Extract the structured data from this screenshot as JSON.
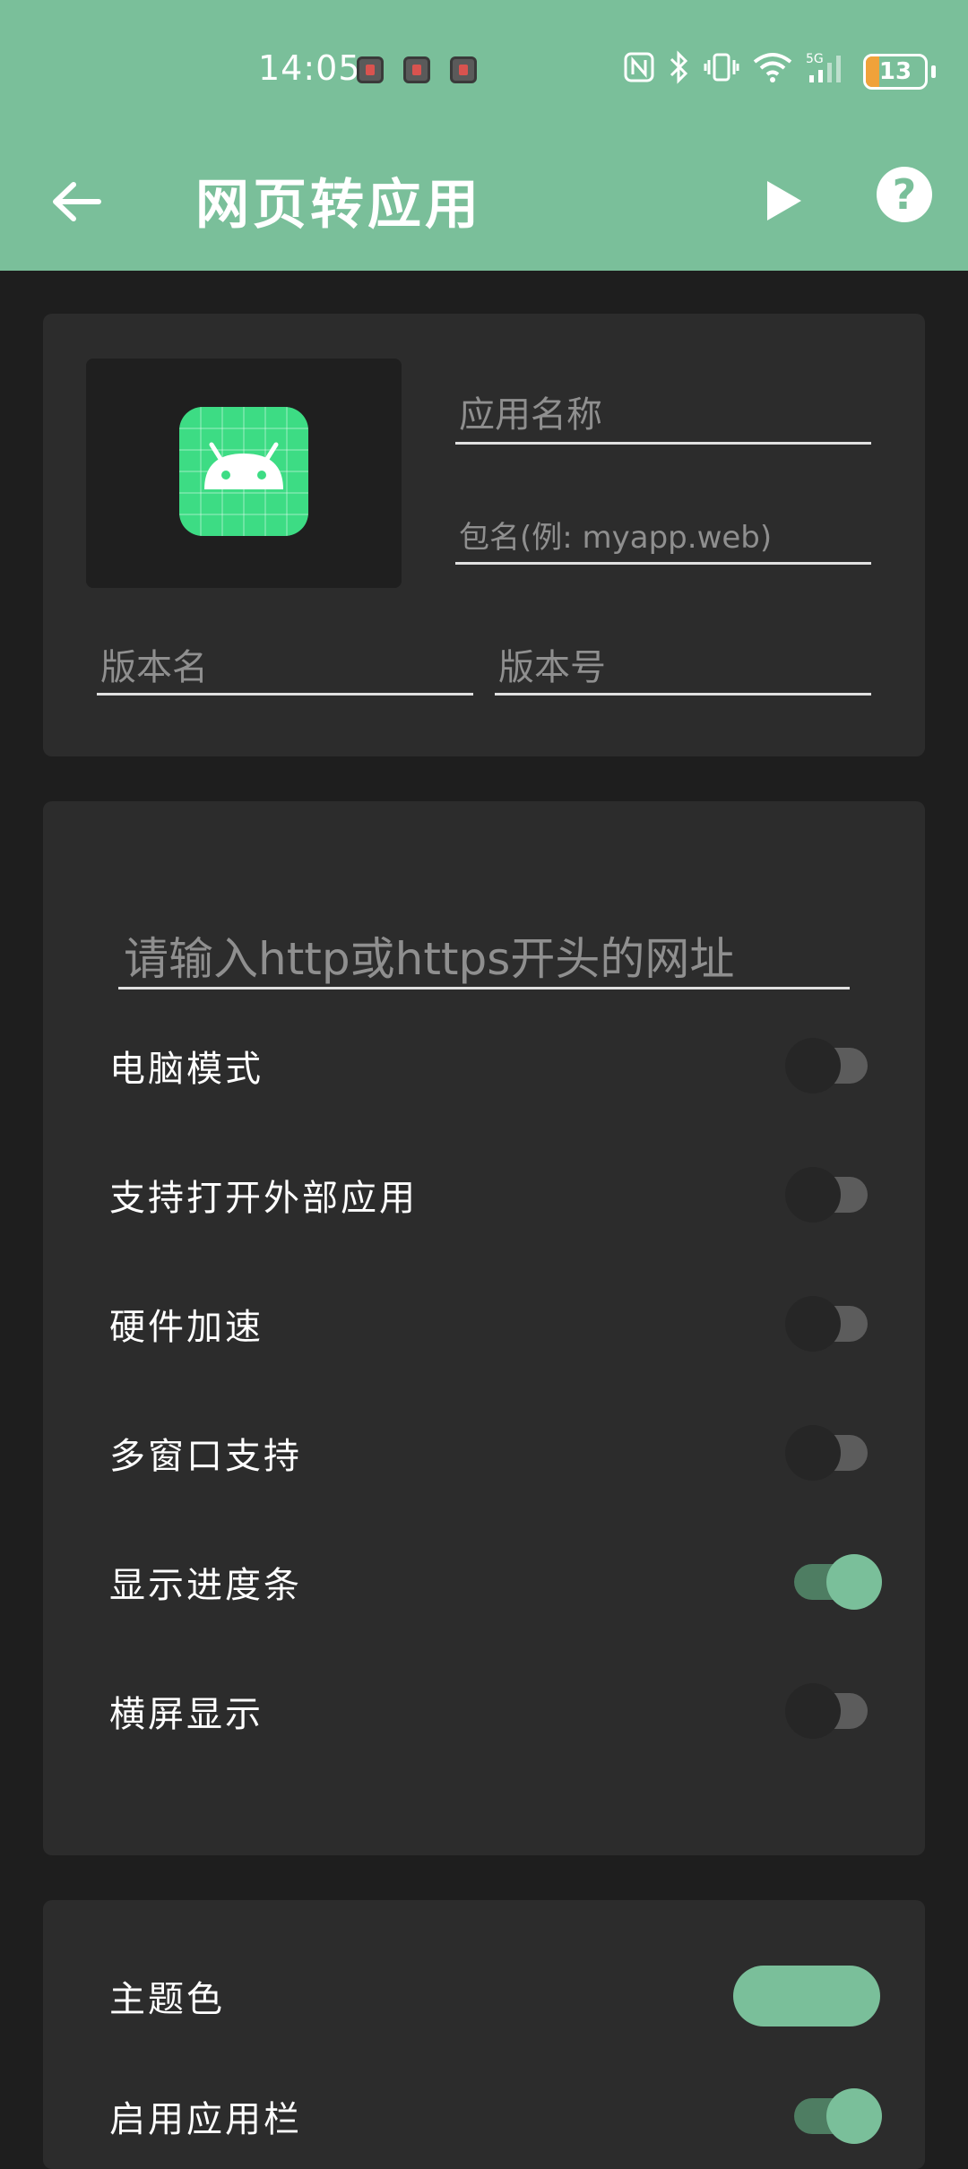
{
  "status_bar": {
    "time": "14:05",
    "battery_level": "13",
    "icons": [
      "nfc-icon",
      "bluetooth-icon",
      "vibrate-icon",
      "wifi-icon",
      "signal-5g-icon"
    ]
  },
  "app_bar": {
    "title": "网页转应用",
    "back_icon": "back-arrow-icon",
    "run_icon": "play-icon",
    "help_icon": "help-icon",
    "help_glyph": "?"
  },
  "app_info": {
    "app_name_placeholder": "应用名称",
    "package_placeholder": "包名(例: myapp.web)",
    "version_name_placeholder": "版本名",
    "version_code_placeholder": "版本号"
  },
  "web_settings": {
    "url_placeholder": "请输入http或https开头的网址",
    "options": [
      {
        "label": "电脑模式",
        "enabled": false
      },
      {
        "label": "支持打开外部应用",
        "enabled": false
      },
      {
        "label": "硬件加速",
        "enabled": false
      },
      {
        "label": "多窗口支持",
        "enabled": false
      },
      {
        "label": "显示进度条",
        "enabled": true
      },
      {
        "label": "横屏显示",
        "enabled": false
      }
    ]
  },
  "theme": {
    "theme_color_label": "主题色",
    "theme_color": "#7abf9a",
    "app_bar_label": "启用应用栏",
    "app_bar_enabled": true
  },
  "colors": {
    "accent": "#7abf9a",
    "background": "#1e1e1e",
    "card": "#2c2c2c"
  }
}
